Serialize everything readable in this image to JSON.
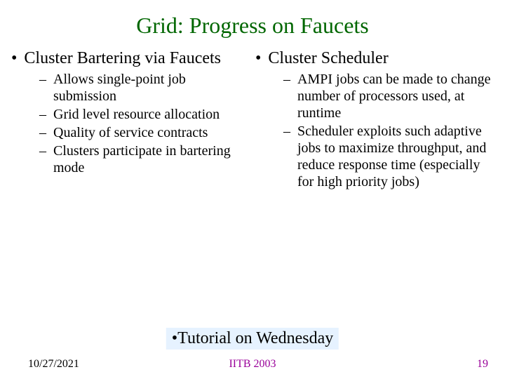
{
  "title": "Grid: Progress on Faucets",
  "left": {
    "heading": "Cluster Bartering via Faucets",
    "items": [
      "Allows single-point job submission",
      "Grid level resource allocation",
      "Quality of service contracts",
      "Clusters participate in bartering mode"
    ]
  },
  "right": {
    "heading": "Cluster Scheduler",
    "items": [
      "AMPI jobs can be made to change number of processors used, at runtime",
      "Scheduler exploits such adaptive jobs to maximize throughput, and reduce response time (especially for high priority jobs)"
    ]
  },
  "tutorial": "Tutorial on Wednesday",
  "footer": {
    "date": "10/27/2021",
    "venue": "IITB 2003",
    "page": "19"
  }
}
